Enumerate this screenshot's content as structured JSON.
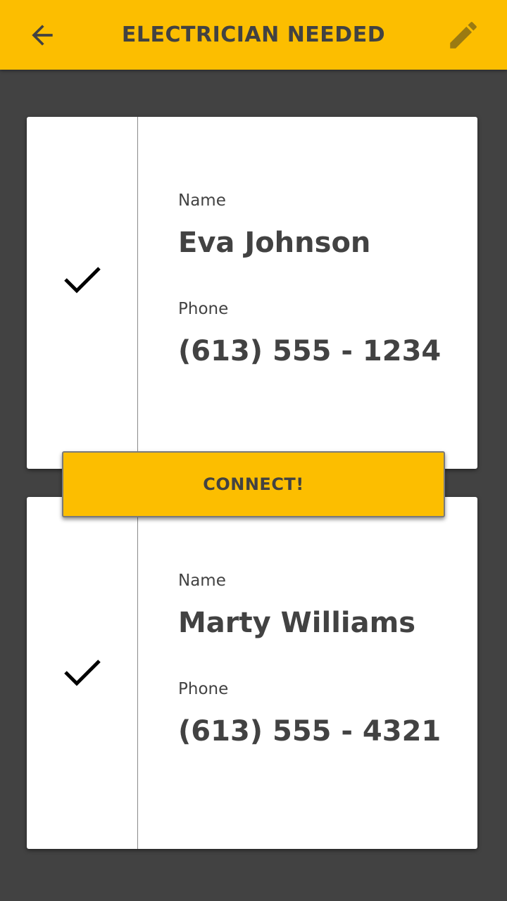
{
  "app_bar": {
    "title": "ELECTRICIAN NEEDED",
    "back_icon": "arrow-left-icon",
    "edit_icon": "pencil-icon",
    "background_color": "#FCBE00"
  },
  "contacts": [
    {
      "name_label": "Name",
      "name": "Eva Johnson",
      "phone_label": "Phone",
      "phone": "(613) 555 - 1234",
      "selected_icon": "checkmark-icon"
    },
    {
      "name_label": "Name",
      "name": "Marty Williams",
      "phone_label": "Phone",
      "phone": "(613) 555 - 4321",
      "selected_icon": "checkmark-icon"
    }
  ],
  "connect_button": {
    "label": "CONNECT!"
  },
  "colors": {
    "accent": "#FCBE00",
    "background": "#424242",
    "text": "#424242",
    "card": "#FFFFFF"
  }
}
